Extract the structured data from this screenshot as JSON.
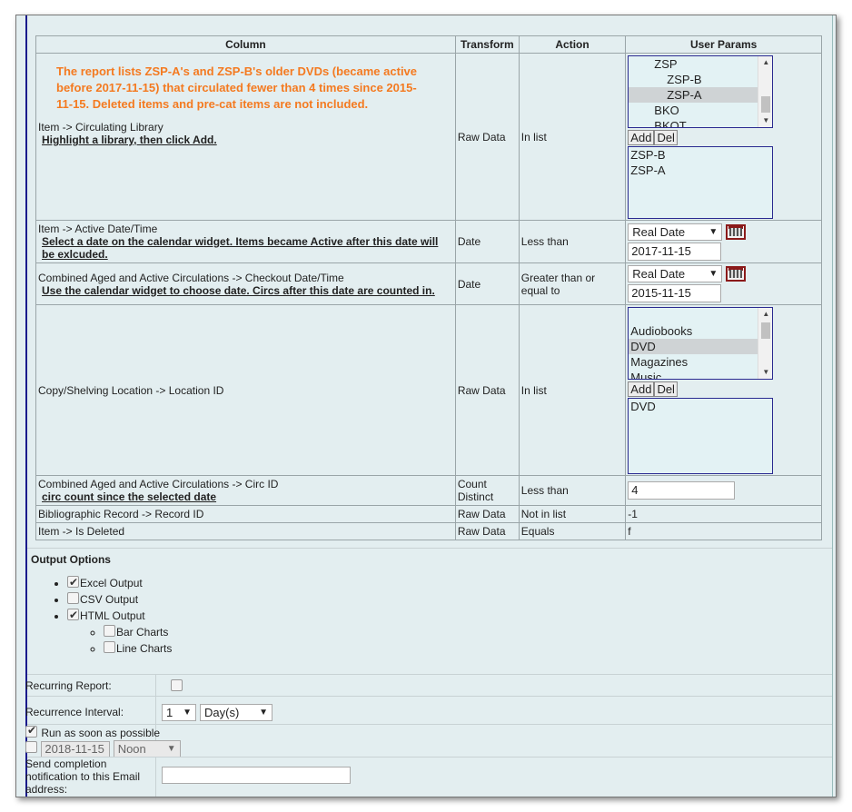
{
  "table": {
    "headers": {
      "column": "Column",
      "transform": "Transform",
      "action": "Action",
      "params": "User Params"
    },
    "note": "The report lists ZSP-A's and ZSP-B's older DVDs (became active before 2017-11-15) that circulated fewer than 4 times since 2015-11-15.  Deleted items and pre-cat items are not included.",
    "rows": [
      {
        "column": "Item -> Circulating Library",
        "hint": "Highlight a library, then click Add.",
        "transform": "Raw Data",
        "action": "In list",
        "tree_options": [
          "ZSP",
          "ZSP-B",
          "ZSP-A",
          "BKO",
          "BKOT"
        ],
        "add_label": "Add",
        "del_label": "Del",
        "selected": [
          "ZSP-B",
          "ZSP-A"
        ]
      },
      {
        "column": "Item -> Active Date/Time",
        "hint": "Select a date on the calendar widget. Items became Active after this date will be exlcuded.",
        "transform": "Date",
        "action": "Less than",
        "date_type": "Real Date",
        "date_value": "2017-11-15"
      },
      {
        "column": "Combined Aged and Active Circulations -> Checkout Date/Time",
        "hint": "Use the calendar widget to choose date. Circs after this date are counted in.",
        "transform": "Date",
        "action": "Greater than or equal to",
        "date_type": "Real Date",
        "date_value": "2015-11-15"
      },
      {
        "column": "Copy/Shelving Location -> Location ID",
        "transform": "Raw Data",
        "action": "In list",
        "options": [
          "",
          "Audiobooks",
          "DVD",
          "Magazines",
          "Music"
        ],
        "add_label": "Add",
        "del_label": "Del",
        "selected": [
          "DVD"
        ]
      },
      {
        "column": "Combined Aged and Active Circulations -> Circ ID",
        "hint": "circ count since the selected date",
        "transform": "Count Distinct",
        "action": "Less than",
        "value": "4"
      },
      {
        "column": "Bibliographic Record -> Record ID",
        "transform": "Raw Data",
        "action": "Not in list",
        "value": "-1"
      },
      {
        "column": "Item -> Is Deleted",
        "transform": "Raw Data",
        "action": "Equals",
        "value": "f"
      }
    ]
  },
  "output": {
    "title": "Output Options",
    "excel": "Excel Output",
    "csv": "CSV Output",
    "html": "HTML Output",
    "bar": "Bar Charts",
    "line": "Line Charts",
    "checked": {
      "excel": true,
      "csv": false,
      "html": true,
      "bar": false,
      "line": false
    }
  },
  "schedule": {
    "recurring_label": "Recurring Report:",
    "interval_label": "Recurrence Interval:",
    "interval_count": "1",
    "interval_unit": "Day(s)",
    "run_asap_label": "Run as soon as possible",
    "run_date": "2018-11-15",
    "run_time": "Noon",
    "email_label": "Send completion notification to this Email address:",
    "email_value": ""
  }
}
